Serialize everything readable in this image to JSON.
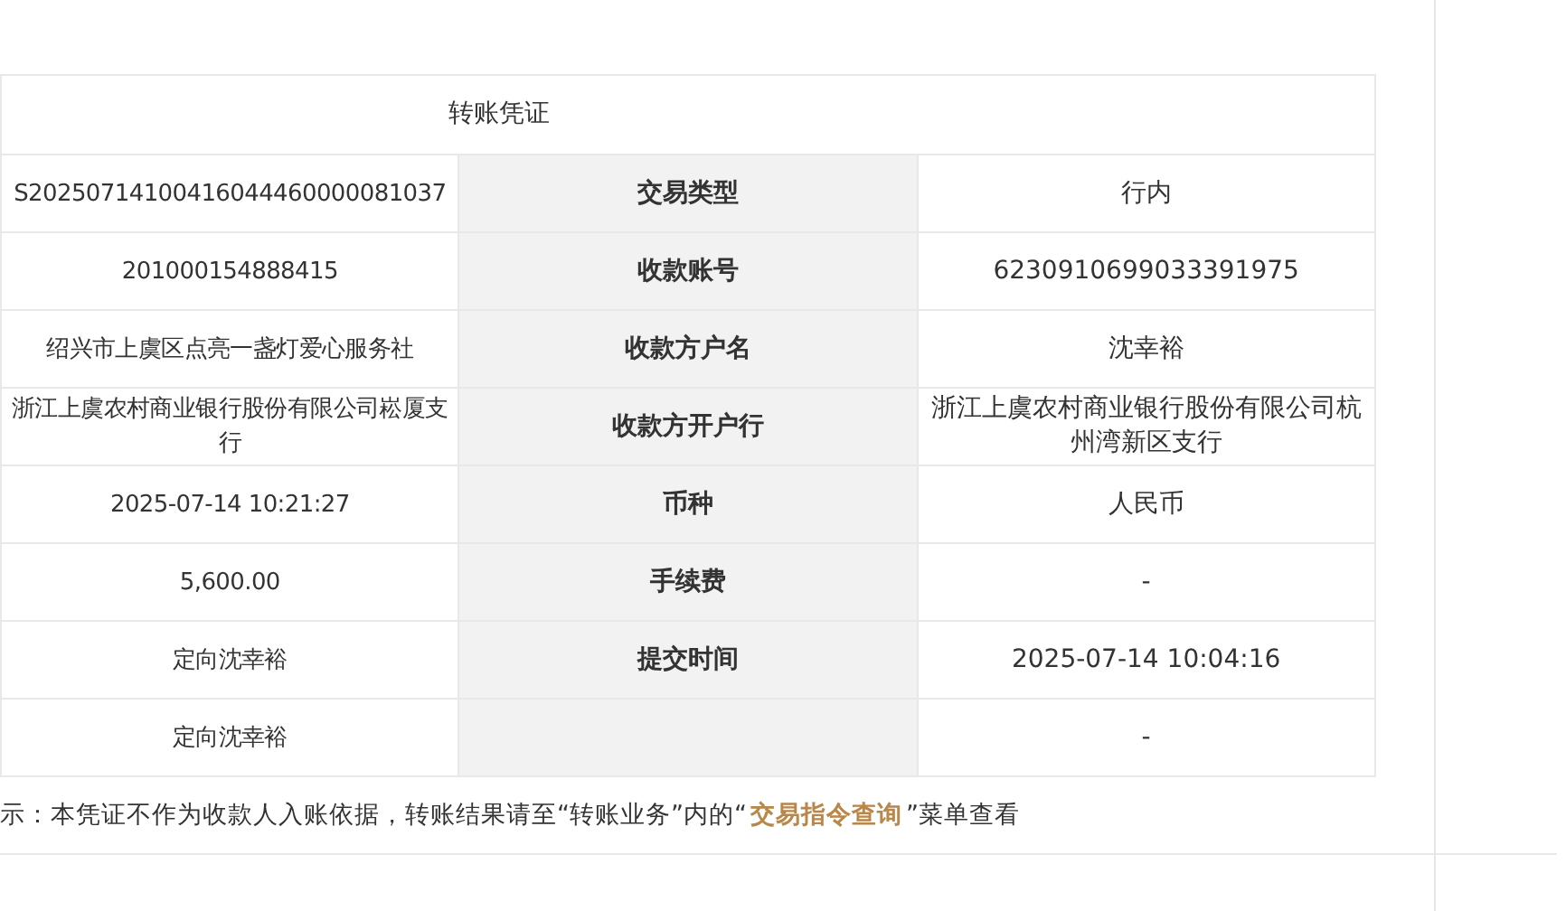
{
  "voucher": {
    "title": "转账凭证",
    "rows": [
      {
        "value_1": "S20250714100416044460000081037",
        "label": "交易类型",
        "value_2": "行内"
      },
      {
        "value_1": "201000154888415",
        "label": "收款账号",
        "value_2": "6230910699033391975"
      },
      {
        "value_1": "绍兴市上虞区点亮一盏灯爱心服务社",
        "label": "收款方户名",
        "value_2": "沈幸裕"
      },
      {
        "value_1": "浙江上虞农村商业银行股份有限公司崧厦支行",
        "label": "收款方开户行",
        "value_2": "浙江上虞农村商业银行股份有限公司杭州湾新区支行"
      },
      {
        "value_1": "2025-07-14 10:21:27",
        "label": "币种",
        "value_2": "人民币"
      },
      {
        "value_1": "5,600.00",
        "label": "手续费",
        "value_2": "-"
      },
      {
        "value_1": "定向沈幸裕",
        "label": "提交时间",
        "value_2": "2025-07-14 10:04:16"
      },
      {
        "value_1": "定向沈幸裕",
        "value_2": "-"
      }
    ]
  },
  "note": {
    "text_before": "示：本凭证不作为收款人入账依据，转账结果请至“转账业务”内的“",
    "link": "交易指令查询",
    "text_after": "”菜单查看"
  }
}
